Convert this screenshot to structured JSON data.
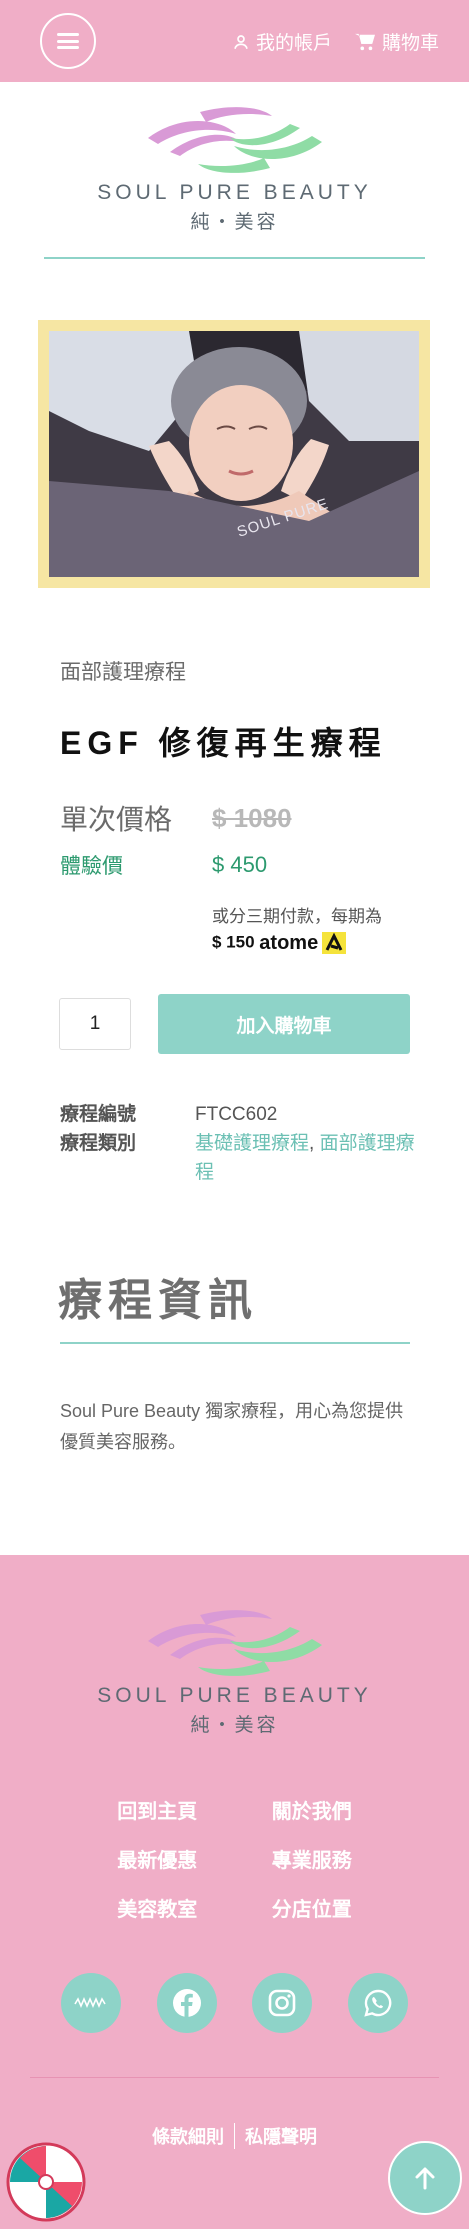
{
  "header": {
    "account_label": "我的帳戶",
    "cart_label": "購物車"
  },
  "brand": {
    "name_en": "SOUL PURE BEAUTY",
    "name_zh": "純・美容"
  },
  "hero": {
    "towel_text": "SOUL PURE"
  },
  "product": {
    "category": "面部護理療程",
    "title": "EGF 修復再生療程",
    "single_price_label": "單次價格",
    "single_price": "$ 1080",
    "trial_label": "體驗價",
    "trial_price": "$ 450",
    "installment_text": "或分三期付款，每期為",
    "installment_amount": "$ 150",
    "installment_provider": "atome",
    "quantity": "1",
    "add_to_cart_label": "加入購物車",
    "sku_label": "療程編號",
    "sku": "FTCC602",
    "category_label": "療程類別",
    "categories": [
      "基礎護理療程",
      "面部護理療程"
    ]
  },
  "info": {
    "section_title": "療程資訊",
    "description": "Soul Pure Beauty 獨家療程，用心為您提供優質美容服務。"
  },
  "footer": {
    "nav": [
      "回到主頁",
      "關於我們",
      "最新優惠",
      "專業服務",
      "美容教室",
      "分店位置"
    ],
    "social_icons": [
      "hktvmall-icon",
      "facebook-icon",
      "instagram-icon",
      "whatsapp-icon"
    ],
    "terms_label": "條款細則",
    "privacy_label": "私隱聲明"
  },
  "colors": {
    "brand_pink": "#f0aec7",
    "brand_teal": "#8ed3c8",
    "price_green": "#2d9a6f",
    "frame_yellow": "#f6e6a3"
  }
}
